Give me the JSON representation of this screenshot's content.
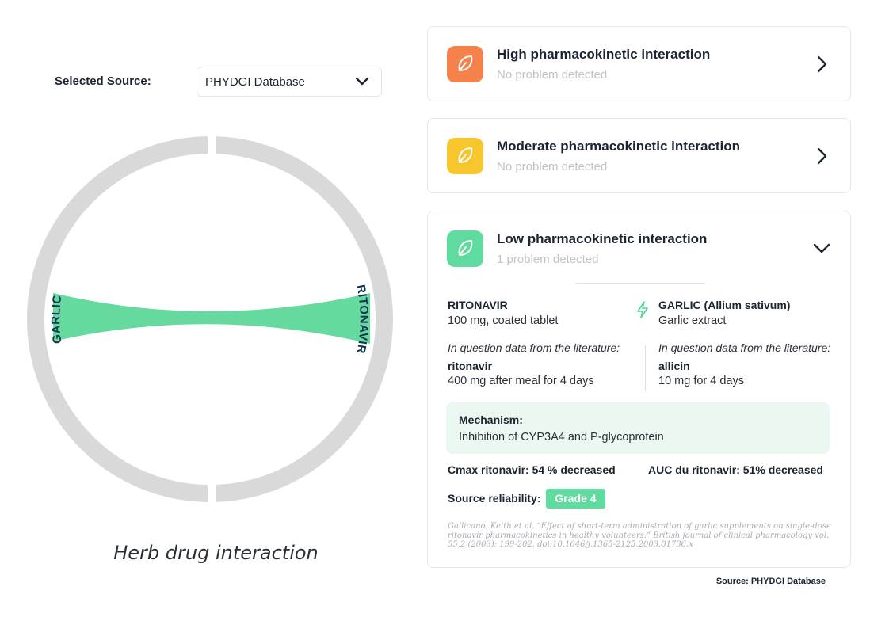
{
  "source_selector": {
    "label": "Selected Source:",
    "value": "PHYDGI Database",
    "icon": "chevron-down-icon"
  },
  "chord": {
    "left_label": "GARLIC",
    "right_label": "RITONAVIR",
    "caption": "Herb drug interaction",
    "ring_color": "#d9d9d9",
    "link_color": "#66d99e",
    "label_color": "#0f3550"
  },
  "interactions": [
    {
      "level": "high",
      "title": "High pharmacokinetic interaction",
      "status": "No problem detected",
      "color": "#f5824a",
      "icon": "leaf-icon",
      "chevron": "chevron-right-icon"
    },
    {
      "level": "moderate",
      "title": "Moderate pharmacokinetic interaction",
      "status": "No problem detected",
      "color": "#f7c52c",
      "icon": "leaf-icon",
      "chevron": "chevron-right-icon"
    },
    {
      "level": "low",
      "title": "Low pharmacokinetic interaction",
      "status": "1 problem detected",
      "color": "#5fdba0",
      "icon": "leaf-icon",
      "chevron": "chevron-down-icon"
    }
  ],
  "detail": {
    "drug": {
      "name": "RITONAVIR",
      "desc": "100 mg, coated tablet",
      "lit_label": "In question data from the literature:",
      "lit_name": "ritonavir",
      "lit_desc": "400 mg after meal for 4 days"
    },
    "herb": {
      "name": "GARLIC (Allium sativum)",
      "desc": "Garlic extract",
      "lit_label": "In question data from the literature:",
      "lit_name": "allicin",
      "lit_desc": "10 mg for 4 days"
    },
    "mechanism_title": "Mechanism:",
    "mechanism_text": "Inhibition of CYP3A4 and P-glycoprotein",
    "cmax": "Cmax ritonavir: 54 % decreased",
    "auc": "AUC du ritonavir: 51% decreased",
    "reliability_label": "Source reliability:",
    "grade": "Grade 4",
    "citation": "Gallicano, Keith et al. “Effect of short-term administration of garlic supplements on single-dose ritonavir pharmacokinetics in healthy volunteers.” British journal of clinical pharmacology vol. 55,2 (2003): 199-202. doi:10.1046/j.1365-2125.2003.01736.x"
  },
  "footer": {
    "prefix": "Source:",
    "link": "PHYDGI Database"
  }
}
